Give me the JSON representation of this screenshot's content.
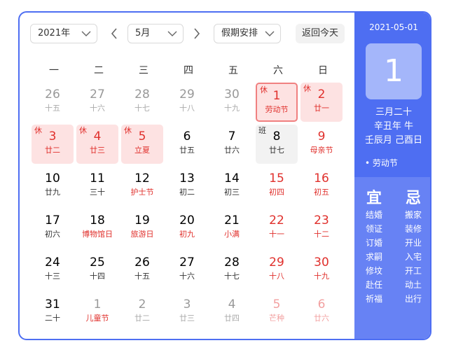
{
  "top_strip": {
    "left_text": "",
    "right_text": ""
  },
  "toolbar": {
    "year": "2021年",
    "month": "5月",
    "holiday": "假期安排",
    "today_label": "返回今天"
  },
  "weekdays": [
    "一",
    "二",
    "三",
    "四",
    "五",
    "六",
    "日"
  ],
  "weeks": [
    [
      {
        "day": "26",
        "lunar": "十五",
        "kind": "other"
      },
      {
        "day": "27",
        "lunar": "十六",
        "kind": "other"
      },
      {
        "day": "28",
        "lunar": "十七",
        "kind": "other"
      },
      {
        "day": "29",
        "lunar": "十八",
        "kind": "other"
      },
      {
        "day": "30",
        "lunar": "十九",
        "kind": "other"
      },
      {
        "day": "1",
        "lunar": "劳动节",
        "kind": "rest",
        "tag": "休",
        "selected": true,
        "red": true
      },
      {
        "day": "2",
        "lunar": "廿一",
        "kind": "rest",
        "tag": "休",
        "red": true
      }
    ],
    [
      {
        "day": "3",
        "lunar": "廿二",
        "kind": "rest",
        "tag": "休",
        "red": true
      },
      {
        "day": "4",
        "lunar": "廿三",
        "kind": "rest",
        "tag": "休",
        "red": true
      },
      {
        "day": "5",
        "lunar": "立夏",
        "kind": "rest",
        "tag": "休",
        "red": true
      },
      {
        "day": "6",
        "lunar": "廿五",
        "kind": "normal"
      },
      {
        "day": "7",
        "lunar": "廿六",
        "kind": "normal"
      },
      {
        "day": "8",
        "lunar": "廿七",
        "kind": "work",
        "tag": "班"
      },
      {
        "day": "9",
        "lunar": "母亲节",
        "kind": "normal",
        "red": true
      }
    ],
    [
      {
        "day": "10",
        "lunar": "廿九",
        "kind": "normal"
      },
      {
        "day": "11",
        "lunar": "三十",
        "kind": "normal"
      },
      {
        "day": "12",
        "lunar": "护士节",
        "kind": "normal",
        "fest": true
      },
      {
        "day": "13",
        "lunar": "初二",
        "kind": "normal"
      },
      {
        "day": "14",
        "lunar": "初三",
        "kind": "normal"
      },
      {
        "day": "15",
        "lunar": "初四",
        "kind": "normal",
        "weekend": true
      },
      {
        "day": "16",
        "lunar": "初五",
        "kind": "normal",
        "weekend": true
      }
    ],
    [
      {
        "day": "17",
        "lunar": "初六",
        "kind": "normal"
      },
      {
        "day": "18",
        "lunar": "博物馆日",
        "kind": "normal",
        "fest": true
      },
      {
        "day": "19",
        "lunar": "旅游日",
        "kind": "normal",
        "fest": true
      },
      {
        "day": "20",
        "lunar": "初九",
        "kind": "normal",
        "fest": true
      },
      {
        "day": "21",
        "lunar": "小满",
        "kind": "normal",
        "fest": true
      },
      {
        "day": "22",
        "lunar": "十一",
        "kind": "normal",
        "weekend": true
      },
      {
        "day": "23",
        "lunar": "十二",
        "kind": "normal",
        "weekend": true
      }
    ],
    [
      {
        "day": "24",
        "lunar": "十三",
        "kind": "normal"
      },
      {
        "day": "25",
        "lunar": "十四",
        "kind": "normal"
      },
      {
        "day": "26",
        "lunar": "十五",
        "kind": "normal"
      },
      {
        "day": "27",
        "lunar": "十六",
        "kind": "normal"
      },
      {
        "day": "28",
        "lunar": "十七",
        "kind": "normal"
      },
      {
        "day": "29",
        "lunar": "十八",
        "kind": "normal",
        "weekend": true
      },
      {
        "day": "30",
        "lunar": "十九",
        "kind": "normal",
        "weekend": true
      }
    ],
    [
      {
        "day": "31",
        "lunar": "二十",
        "kind": "normal"
      },
      {
        "day": "1",
        "lunar": "儿童节",
        "kind": "other",
        "fest": true
      },
      {
        "day": "2",
        "lunar": "廿二",
        "kind": "other"
      },
      {
        "day": "3",
        "lunar": "廿三",
        "kind": "other"
      },
      {
        "day": "4",
        "lunar": "廿四",
        "kind": "other"
      },
      {
        "day": "5",
        "lunar": "芒种",
        "kind": "other-red"
      },
      {
        "day": "6",
        "lunar": "廿六",
        "kind": "other-red"
      }
    ]
  ],
  "side": {
    "date": "2021-05-01",
    "day": "1",
    "lunar_date": "三月二十",
    "ganzhi_year": "辛丑年 牛",
    "ganzhi_month_day": "壬辰月 己酉日",
    "festival": "• 劳动节",
    "yi_label": "宜",
    "ji_label": "忌",
    "yi": [
      "结婚",
      "领证",
      "订婚",
      "求嗣",
      "修坟",
      "赴任",
      "祈福"
    ],
    "ji": [
      "搬家",
      "装修",
      "开业",
      "入宅",
      "开工",
      "动土",
      "出行"
    ]
  },
  "colors": {
    "accent": "#4e6ef2",
    "rest_bg": "#fde2e2",
    "holiday_red": "#e0302c",
    "work_bg": "#f2f2f2"
  }
}
